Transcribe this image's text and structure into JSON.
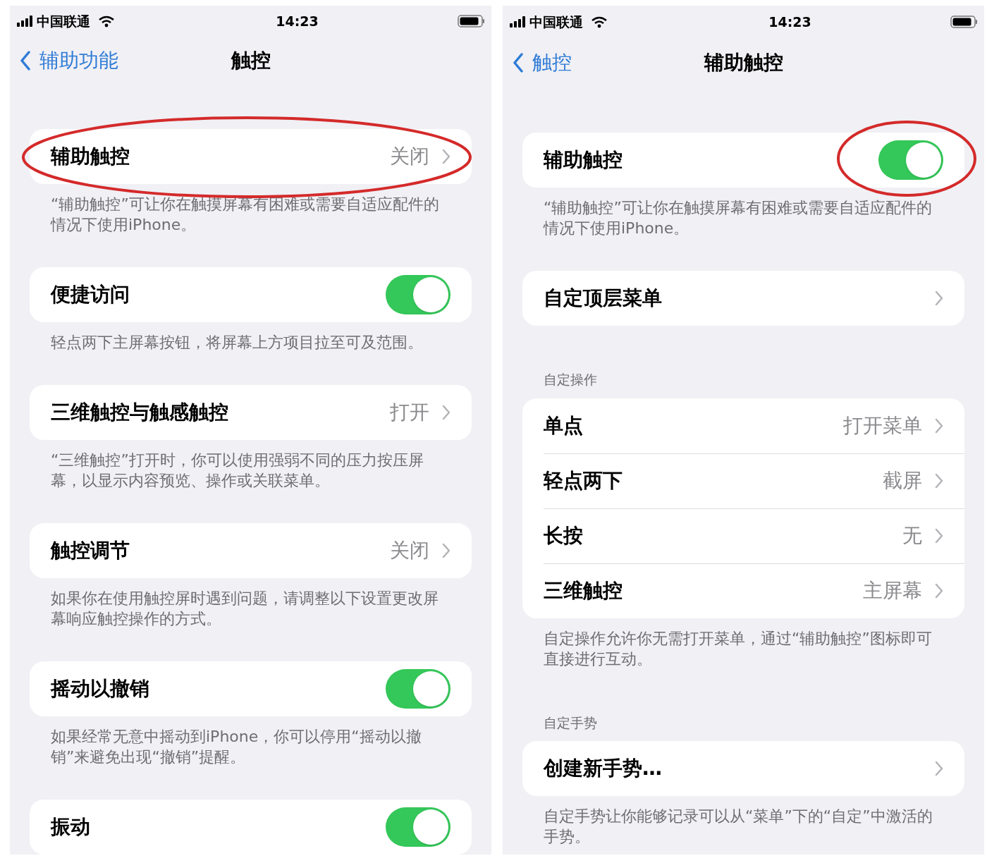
{
  "phones": [
    {
      "status_bar": {
        "carrier": "中国联通",
        "time": "14:23"
      },
      "nav": {
        "back": "辅助功能",
        "title": "触控"
      },
      "sections": [
        {
          "rows": [
            {
              "kind": "value",
              "label": "辅助触控",
              "value": "关闭",
              "circled": true
            }
          ],
          "footer": "“辅助触控”可让你在触摸屏幕有困难或需要自适应配件的情况下使用iPhone。"
        },
        {
          "rows": [
            {
              "kind": "toggle",
              "label": "便捷访问",
              "on": true
            }
          ],
          "footer": "轻点两下主屏幕按钮，将屏幕上方项目拉至可及范围。"
        },
        {
          "rows": [
            {
              "kind": "value",
              "label": "三维触控与触感触控",
              "value": "打开"
            }
          ],
          "footer": "“三维触控”打开时，你可以使用强弱不同的压力按压屏幕，以显示内容预览、操作或关联菜单。"
        },
        {
          "rows": [
            {
              "kind": "value",
              "label": "触控调节",
              "value": "关闭"
            }
          ],
          "footer": "如果你在使用触控屏时遇到问题，请调整以下设置更改屏幕响应触控操作的方式。"
        },
        {
          "rows": [
            {
              "kind": "toggle",
              "label": "摇动以撤销",
              "on": true
            }
          ],
          "footer": "如果经常无意中摇动到iPhone，你可以停用“摇动以撤销”来避免出现“撤销”提醒。"
        },
        {
          "rows": [
            {
              "kind": "toggle",
              "label": "振动",
              "on": true
            }
          ]
        }
      ]
    },
    {
      "status_bar": {
        "carrier": "中国联通",
        "time": "14:23"
      },
      "nav": {
        "back": "触控",
        "title": "辅助触控"
      },
      "sections": [
        {
          "rows": [
            {
              "kind": "toggle",
              "label": "辅助触控",
              "on": true,
              "circled": true
            }
          ],
          "footer": "“辅助触控”可让你在触摸屏幕有困难或需要自适应配件的情况下使用iPhone。"
        },
        {
          "rows": [
            {
              "kind": "value",
              "label": "自定顶层菜单"
            }
          ]
        },
        {
          "header": "自定操作",
          "rows": [
            {
              "kind": "value",
              "label": "单点",
              "value": "打开菜单"
            },
            {
              "kind": "value",
              "label": "轻点两下",
              "value": "截屏"
            },
            {
              "kind": "value",
              "label": "长按",
              "value": "无"
            },
            {
              "kind": "value",
              "label": "三维触控",
              "value": "主屏幕"
            }
          ],
          "footer": "自定操作允许你无需打开菜单，通过“辅助触控”图标即可直接进行互动。"
        },
        {
          "header": "自定手势",
          "rows": [
            {
              "kind": "value",
              "label": "创建新手势…"
            }
          ],
          "footer": "自定手势让你能够记录可以从“菜单”下的“自定”中激活的手势。"
        }
      ]
    }
  ]
}
